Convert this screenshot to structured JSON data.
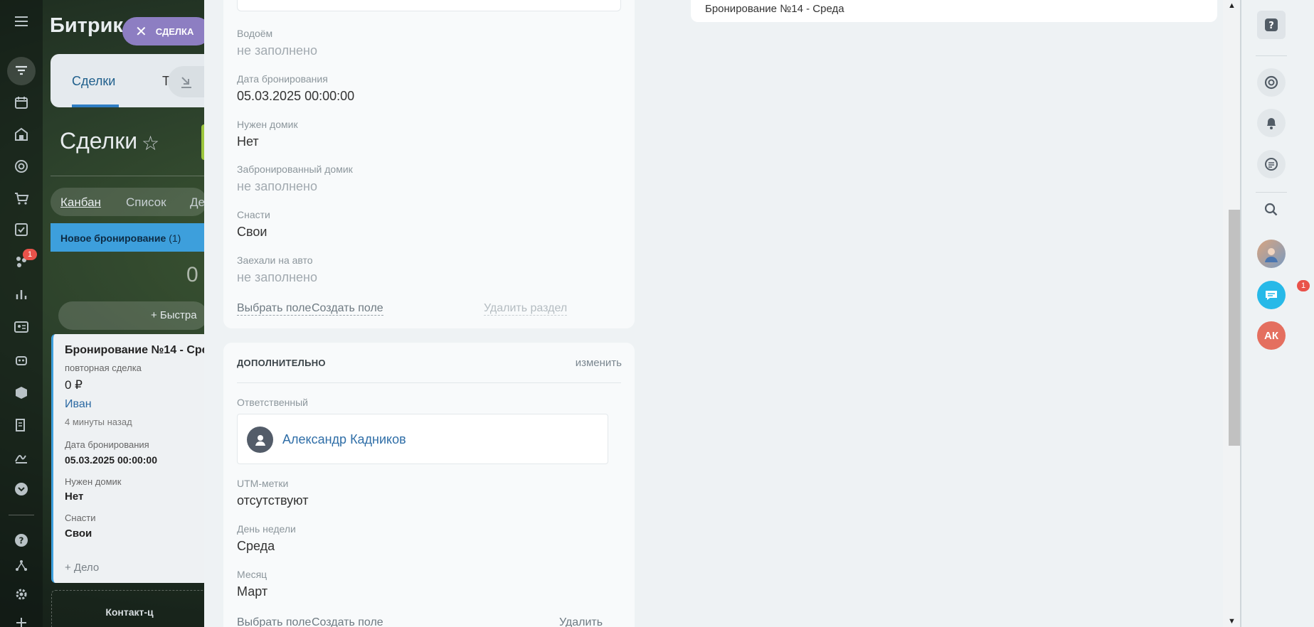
{
  "portal": {
    "brand": "Битрик",
    "slider_pill": "СДЕЛКА",
    "tabs": {
      "deals": "Сделки",
      "t": "Т"
    },
    "page_title": "Сделки",
    "view_tabs": {
      "kanban": "Канбан",
      "list": "Список",
      "de": "Де"
    },
    "stage": {
      "name": "Новое бронирование",
      "count": "(1)",
      "sum": "0"
    },
    "quick_add": "+ Быстра",
    "rail_badge": "1",
    "deal_card": {
      "title": "Бронирование №14 - Сре",
      "subtitle": "повторная сделка",
      "price": "0 ₽",
      "client": "Иван",
      "time": "4 минуты назад",
      "fields": [
        {
          "label": "Дата бронирования",
          "value": "05.03.2025 00:00:00"
        },
        {
          "label": "Нужен домик",
          "value": "Нет"
        },
        {
          "label": "Снасти",
          "value": "Свои"
        }
      ],
      "add_activity": "+ Дело"
    },
    "contact_card": "Контакт-ц"
  },
  "main_section": {
    "fields": [
      {
        "label": "Водоём",
        "value": "не заполнено"
      },
      {
        "label": "Дата бронирования",
        "value": "05.03.2025 00:00:00"
      },
      {
        "label": "Нужен домик",
        "value": "Нет"
      },
      {
        "label": "Забронированный домик",
        "value": "не заполнено"
      },
      {
        "label": "Снасти",
        "value": "Свои"
      },
      {
        "label": "Заехали на авто",
        "value": "не заполнено"
      }
    ],
    "actions": {
      "choose_field": "Выбрать поле",
      "create_field": "Создать поле",
      "delete_section": "Удалить раздел"
    }
  },
  "extra_section": {
    "title": "ДОПОЛНИТЕЛЬНО",
    "edit": "изменить",
    "responsible_label": "Ответственный",
    "responsible_name": "Александр Кадников",
    "fields": [
      {
        "label": "UTM-метки",
        "value": "отсутствуют"
      },
      {
        "label": "День недели",
        "value": "Среда"
      },
      {
        "label": "Месяц",
        "value": "Март"
      }
    ],
    "actions": {
      "choose_field": "Выбрать поле",
      "create_field": "Создать поле",
      "delete_section": "Удалить раздел"
    }
  },
  "right_panel": {
    "title": "Бронирование №14 - Среда"
  },
  "right_bar": {
    "help": "?",
    "chat_badge": "1",
    "user_initials": "АК"
  }
}
